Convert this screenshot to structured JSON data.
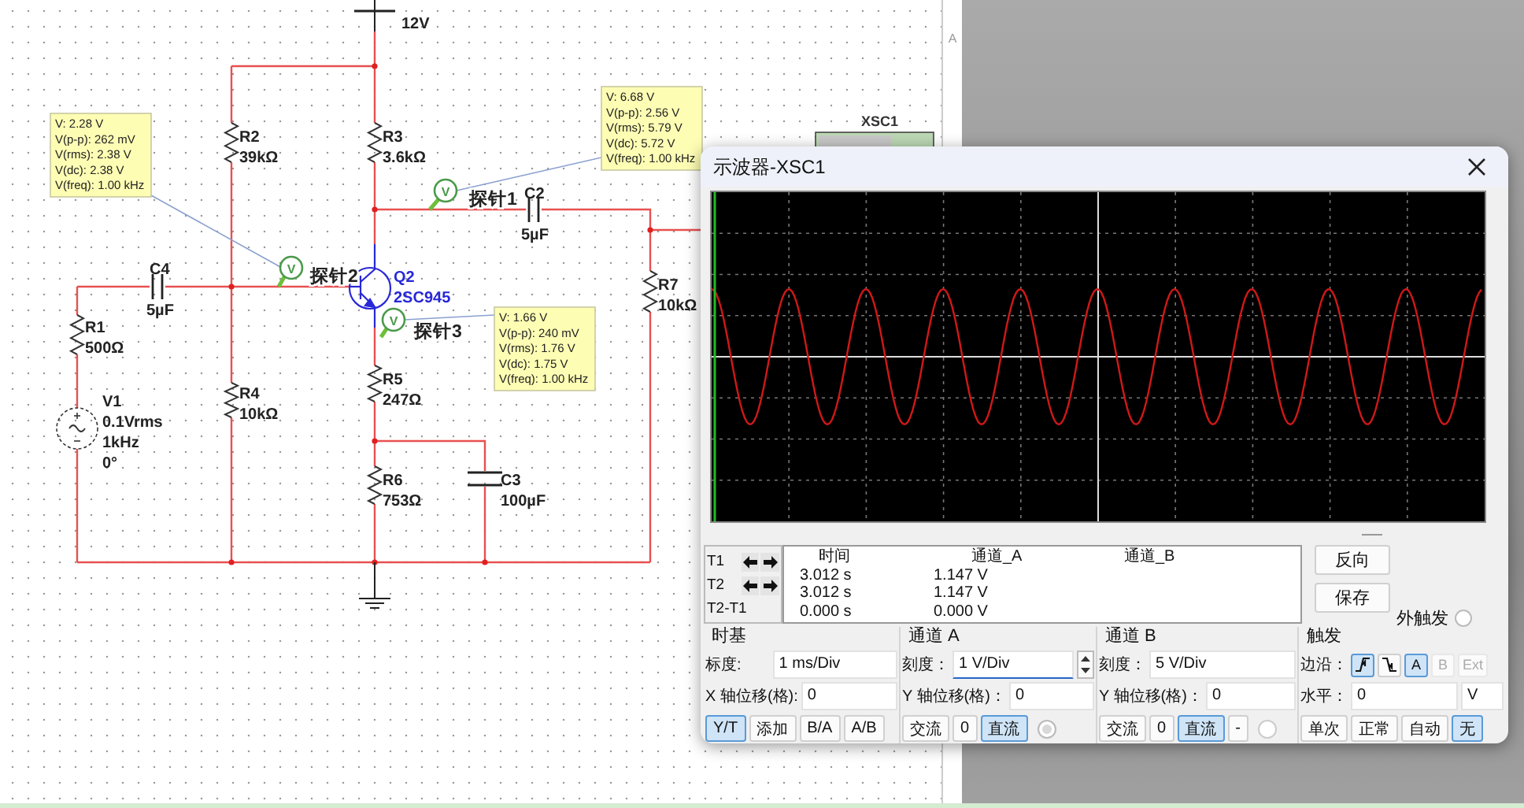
{
  "canvas": {
    "ruler_label": "A"
  },
  "schematic": {
    "supply": {
      "value": "12V"
    },
    "components": [
      {
        "kind": "resistor",
        "ref": "R1",
        "values": [
          "500Ω"
        ]
      },
      {
        "kind": "resistor",
        "ref": "R2",
        "values": [
          "39kΩ"
        ]
      },
      {
        "kind": "resistor",
        "ref": "R3",
        "values": [
          "3.6kΩ"
        ]
      },
      {
        "kind": "resistor",
        "ref": "R4",
        "values": [
          "10kΩ"
        ]
      },
      {
        "kind": "resistor",
        "ref": "R5",
        "values": [
          "247Ω"
        ]
      },
      {
        "kind": "resistor",
        "ref": "R6",
        "values": [
          "753Ω"
        ]
      },
      {
        "kind": "resistor",
        "ref": "R7",
        "values": [
          "10kΩ"
        ]
      },
      {
        "kind": "capacitor",
        "ref": "C2",
        "values": [
          "5µF"
        ]
      },
      {
        "kind": "capacitor",
        "ref": "C3",
        "values": [
          "100µF"
        ]
      },
      {
        "kind": "capacitor",
        "ref": "C4",
        "values": [
          "5µF"
        ]
      },
      {
        "kind": "transistor",
        "ref": "Q2",
        "values": [
          "2SC945"
        ]
      },
      {
        "kind": "source",
        "ref": "V1",
        "values": [
          "0.1Vrms",
          "1kHz",
          "0°"
        ]
      }
    ],
    "probes": [
      {
        "label": "探针1",
        "marker": "V",
        "readings": [
          "V: 6.68 V",
          "V(p-p): 2.56 V",
          "V(rms): 5.79 V",
          "V(dc): 5.72 V",
          "V(freq): 1.00 kHz"
        ]
      },
      {
        "label": "探针2",
        "marker": "V",
        "readings": [
          "V: 2.28 V",
          "V(p-p): 262 mV",
          "V(rms): 2.38 V",
          "V(dc): 2.38 V",
          "V(freq): 1.00 kHz"
        ]
      },
      {
        "label": "探针3",
        "marker": "V",
        "readings": [
          "V: 1.66 V",
          "V(p-p): 240 mV",
          "V(rms): 1.76 V",
          "V(dc): 1.75 V",
          "V(freq): 1.00 kHz"
        ]
      }
    ],
    "instrument": {
      "label": "XSC1"
    }
  },
  "oscilloscope": {
    "title": "示波器-XSC1",
    "cursors": {
      "columns": [
        "时间",
        "通道_A",
        "通道_B"
      ],
      "rows": [
        {
          "label": "T1",
          "arrows": true,
          "values": [
            "3.012 s",
            "1.147 V"
          ]
        },
        {
          "label": "T2",
          "arrows": true,
          "values": [
            "3.012 s",
            "1.147 V"
          ]
        },
        {
          "label": "T2-T1",
          "arrows": false,
          "values": [
            "0.000 s",
            "0.000 V"
          ]
        }
      ]
    },
    "actions": [
      "反向",
      "保存"
    ],
    "external_trigger": {
      "label": "外触发",
      "selected": false
    },
    "timebase": {
      "title": "时基",
      "fields": [
        {
          "label": "标度:",
          "value": "1 ms/Div",
          "focused": false
        },
        {
          "label": "X 轴位移(格):",
          "value": "0",
          "focused": false
        }
      ],
      "modes": [
        {
          "label": "Y/T",
          "selected": true
        },
        {
          "label": "添加",
          "selected": false
        },
        {
          "label": "B/A",
          "selected": false
        },
        {
          "label": "A/B",
          "selected": false
        }
      ]
    },
    "channels": [
      {
        "title": "通道 A",
        "indicator_on": true,
        "fields": [
          {
            "label": "刻度：",
            "value": "1  V/Div",
            "focused": true
          },
          {
            "label": "Y 轴位移(格)：",
            "value": "0",
            "focused": false
          }
        ],
        "coupling": [
          {
            "label": "交流",
            "selected": false
          },
          {
            "label": "0",
            "selected": false
          },
          {
            "label": "直流",
            "selected": true
          }
        ]
      },
      {
        "title": "通道 B",
        "indicator_on": false,
        "fields": [
          {
            "label": "刻度：",
            "value": "5  V/Div",
            "focused": false
          },
          {
            "label": "Y 轴位移(格)：",
            "value": "0",
            "focused": false
          }
        ],
        "coupling": [
          {
            "label": "交流",
            "selected": false
          },
          {
            "label": "0",
            "selected": false
          },
          {
            "label": "直流",
            "selected": true
          },
          {
            "label": "-",
            "selected": false
          }
        ]
      }
    ],
    "trigger": {
      "title": "触发",
      "edge_label": "边沿：",
      "edges": [
        {
          "kind": "rising",
          "selected": true
        },
        {
          "kind": "falling",
          "selected": false
        }
      ],
      "sources": [
        {
          "label": "A",
          "selected": true,
          "disabled": false
        },
        {
          "label": "B",
          "selected": false,
          "disabled": true
        },
        {
          "label": "Ext",
          "selected": false,
          "disabled": true
        }
      ],
      "threshold_label": "水平：",
      "threshold": {
        "value": "0",
        "unit": "V"
      },
      "modes": [
        {
          "label": "单次",
          "selected": false
        },
        {
          "label": "正常",
          "selected": false
        },
        {
          "label": "自动",
          "selected": false
        },
        {
          "label": "无",
          "selected": true
        }
      ]
    }
  }
}
